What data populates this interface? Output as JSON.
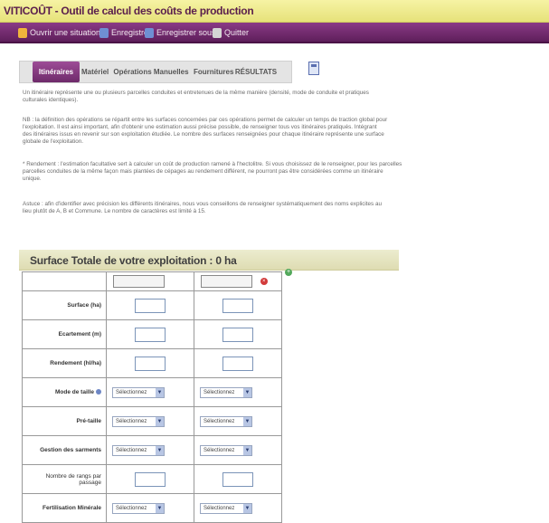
{
  "app": {
    "title": "VITICOÛT - Outil de calcul des coûts de production"
  },
  "menu": {
    "items": [
      {
        "label": "Ouvrir une situation",
        "icon": "folder-icon"
      },
      {
        "label": "Enregistrer",
        "icon": "save-icon"
      },
      {
        "label": "Enregistrer sous",
        "icon": "save-as-icon"
      },
      {
        "label": "Quitter",
        "icon": "exit-icon"
      }
    ]
  },
  "tabs": [
    {
      "label": "Itinéraires",
      "active": true
    },
    {
      "label": "Matériel",
      "active": false
    },
    {
      "label": "Opérations Manuelles",
      "active": false
    },
    {
      "label": "Fournitures",
      "active": false
    },
    {
      "label": "RÉSULTATS",
      "active": false
    }
  ],
  "paragraphs": [
    [
      "Un itinéraire représente une ou plusieurs parcelles conduites et entretenues de la même manière (densité, mode de conduite et pratiques",
      "culturales identiques)."
    ],
    [
      "NB : la définition des opérations se répartit entre les surfaces concernées par ces opérations permet de calculer un temps de traction global pour",
      "l'exploitation. Il est ainsi important, afin d'obtenir une estimation aussi précise possible, de renseigner tous vos itinéraires pratiqués. Intégrant",
      "des itinéraires issus en revenir sur son exploitation étudiée. Le nombre des surfaces renseignées pour chaque itinéraire représente une surface",
      "globale de l'exploitation."
    ],
    [
      "* Rendement : l'estimation facultative sert à calculer un coût de production ramené à l'hectolitre. Si vous choisissez de le renseigner, pour les parcelles",
      "parcelles conduites de la même façon mais plantées de cépages au rendement différent, ne pourront pas être considérées comme un itinéraire",
      "unique."
    ],
    [
      "Astuce : afin d'identifier avec précision les différents itinéraires, nous vous conseillons de renseigner systématiquement des noms explicites au",
      "lieu plutôt de A, B et Commune. Le nombre de caractères est limité à 15."
    ]
  ],
  "surface": {
    "label": "Surface Totale de votre exploitation : 0 ha"
  },
  "table": {
    "rows": [
      {
        "label": "Surface (ha)",
        "type": "input"
      },
      {
        "label": "Ecartement (m)",
        "type": "input"
      },
      {
        "label": "Rendement (hl/ha)",
        "type": "input"
      },
      {
        "label": "Mode de taille",
        "type": "select",
        "help": true
      },
      {
        "label": "Pré-taille",
        "type": "select"
      },
      {
        "label": "Gestion des sarments",
        "type": "select"
      },
      {
        "label": "Nombre de rangs par passage",
        "type": "input"
      },
      {
        "label": "Fertilisation Minérale",
        "type": "select"
      }
    ],
    "select_placeholder": "Sélectionnez"
  }
}
